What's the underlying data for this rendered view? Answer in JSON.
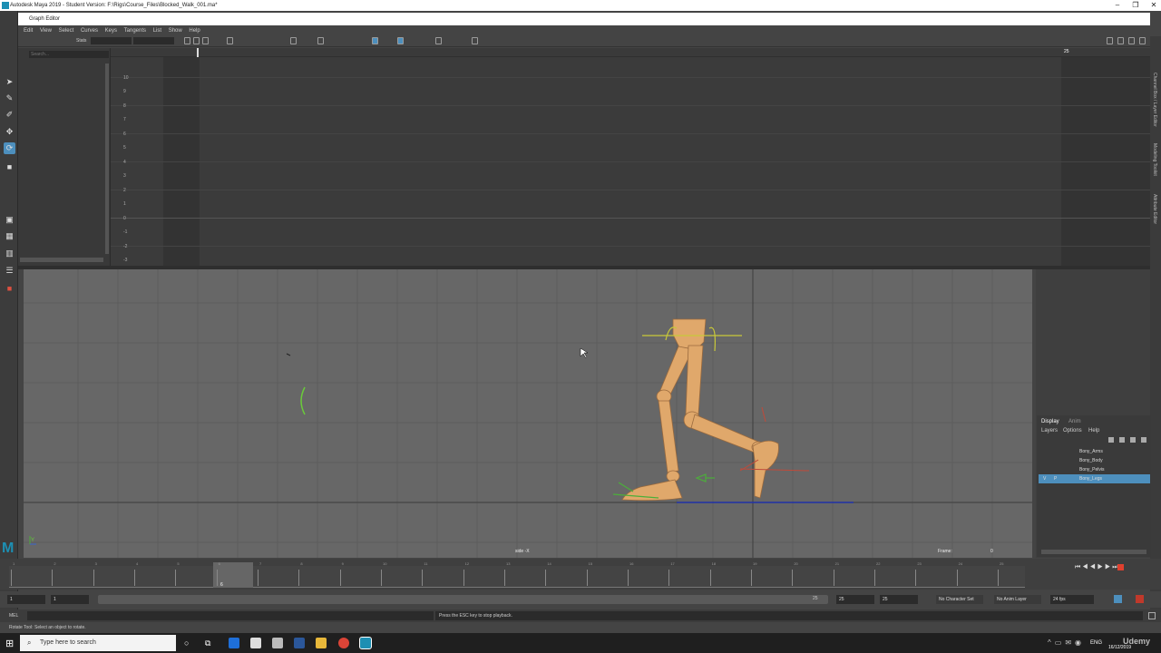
{
  "app_title": "Autodesk Maya 2019 - Student Version: F:\\Rigs\\Course_Files\\Blocked_Walk_001.ma*",
  "window_controls": {
    "minimize": "–",
    "maximize": "❐",
    "close": "✕"
  },
  "graph_editor": {
    "title": "Graph Editor",
    "menu": [
      "Edit",
      "View",
      "Select",
      "Curves",
      "Keys",
      "Tangents",
      "List",
      "Show",
      "Help"
    ],
    "stats_label": "Stats",
    "search_placeholder": "Search...",
    "y_labels": [
      "10",
      "9",
      "8",
      "7",
      "6",
      "5",
      "4",
      "3",
      "2",
      "1",
      "0",
      "-1",
      "-2",
      "-3"
    ],
    "ruler_end_frame": "25"
  },
  "viewport": {
    "camera_label": "side -X",
    "frame_label": "Frame:",
    "frame_value": "0"
  },
  "right_tabs": [
    "Channel Box / Layer Editor",
    "Modeling Toolkit",
    "Attribute Editor"
  ],
  "layer_editor": {
    "tabs": [
      "Display",
      "Anim"
    ],
    "menu": [
      "Layers",
      "Options",
      "Help"
    ],
    "layers": [
      {
        "name": "Bony_Arms",
        "v": "",
        "p": "",
        "selected": false
      },
      {
        "name": "Bony_Body",
        "v": "",
        "p": "",
        "selected": false
      },
      {
        "name": "Bony_Pelvis",
        "v": "",
        "p": "",
        "selected": false
      },
      {
        "name": "Bony_Legs",
        "v": "V",
        "p": "P",
        "selected": true
      }
    ]
  },
  "time_slider": {
    "ticks": [
      "1",
      "2",
      "3",
      "4",
      "5",
      "6",
      "7",
      "8",
      "9",
      "10",
      "11",
      "12",
      "13",
      "14",
      "15",
      "16",
      "17",
      "18",
      "19",
      "20",
      "21",
      "22",
      "23",
      "24",
      "25"
    ],
    "current": "6"
  },
  "range": {
    "start": "1",
    "anim_start": "1",
    "range_end": "25",
    "end": "25",
    "anim_end": "25",
    "character_set": "No Character Set",
    "anim_layer": "No Anim Layer",
    "fps": "24 fps"
  },
  "command_line": {
    "label": "MEL",
    "result": "Press the ESC key to stop playback."
  },
  "help_line": "Rotate Tool: Select an object to rotate.",
  "taskbar": {
    "search_placeholder": "Type here to search",
    "lang": "ENG",
    "date": "16/12/2019",
    "watermark": "Udemy"
  },
  "colors": {
    "accent": "#4d8fbd",
    "leg": "#e0a86b",
    "selection": "#4d8fbd"
  }
}
